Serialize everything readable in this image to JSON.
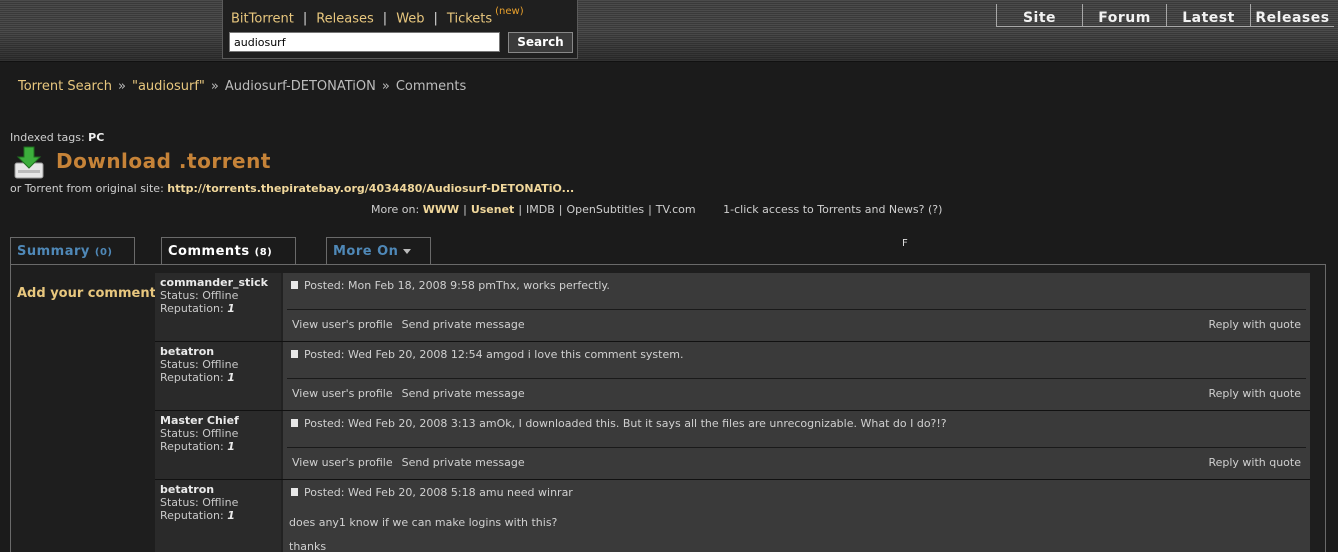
{
  "search": {
    "tabs": [
      "BitTorrent",
      "Releases",
      "Web",
      "Tickets"
    ],
    "new_badge": "(new)",
    "query": "audiosurf",
    "button": "Search"
  },
  "topnav": [
    "Site",
    "Forum",
    "Latest",
    "Releases"
  ],
  "breadcrumb": {
    "items": [
      "Torrent Search",
      "\"audiosurf\"",
      "Audiosurf-DETONATiON",
      "Comments"
    ],
    "separator": "»"
  },
  "tags": {
    "label": "Indexed tags:",
    "value": "PC"
  },
  "download": {
    "title": "Download .torrent",
    "origin_label": "or Torrent from original site:",
    "origin_url": "http://torrents.thepiratebay.org/4034480/Audiosurf-DETONATiO..."
  },
  "more_on": {
    "label": "More on:",
    "links": [
      "WWW",
      "Usenet",
      "IMDB",
      "OpenSubtitles",
      "TV.com"
    ],
    "one_click": "1-click access to Torrents and News? (?)"
  },
  "f_mark": "F",
  "tabs": {
    "summary": "Summary",
    "summary_count": "(0)",
    "comments": "Comments",
    "comments_count": "(8)",
    "more": "More On"
  },
  "add_comment": "Add your comment",
  "comments": [
    {
      "user": "commander_stick",
      "status": "Status: Offline",
      "rep_label": "Reputation:",
      "rep": "1",
      "posted": "Posted: Mon Feb 18, 2008 9:58 pm",
      "text": "Thx, works perfectly.",
      "profile": "View user's profile",
      "pm": "Send private message",
      "quote": "Reply with quote"
    },
    {
      "user": "betatron",
      "status": "Status: Offline",
      "rep_label": "Reputation:",
      "rep": "1",
      "posted": "Posted: Wed Feb 20, 2008 12:54 am",
      "text": "god i love this comment system.",
      "profile": "View user's profile",
      "pm": "Send private message",
      "quote": "Reply with quote"
    },
    {
      "user": "Master Chief",
      "status": "Status: Offline",
      "rep_label": "Reputation:",
      "rep": "1",
      "posted": "Posted: Wed Feb 20, 2008 3:13 am",
      "text": "Ok, I downloaded this. But it says all the files are unrecognizable. What do I do?!?",
      "profile": "View user's profile",
      "pm": "Send private message",
      "quote": "Reply with quote"
    },
    {
      "user": "betatron",
      "status": "Status: Offline",
      "rep_label": "Reputation:",
      "rep": "1",
      "posted": "Posted: Wed Feb 20, 2008 5:18 am",
      "text": "u need winrar",
      "line2": "does any1 know if we can make logins with this?",
      "line3": "thanks"
    }
  ]
}
